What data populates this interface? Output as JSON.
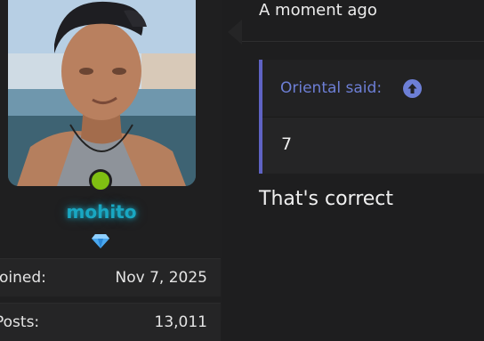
{
  "user": {
    "username": "mohito",
    "status": "online",
    "status_color": "#7fbf12",
    "username_color": "#19a7c2",
    "badge_icon": "gem-icon",
    "stats": [
      {
        "label": "Joined:",
        "value": "Nov 7, 2025"
      },
      {
        "label": "Posts:",
        "value": "13,011"
      }
    ]
  },
  "message": {
    "timestamp": "A moment ago",
    "quote": {
      "author_label": "Oriental said:",
      "icon": "arrow-up-circle-icon",
      "accent": "#6d7fd6",
      "body": "7"
    },
    "text": "That's correct"
  }
}
